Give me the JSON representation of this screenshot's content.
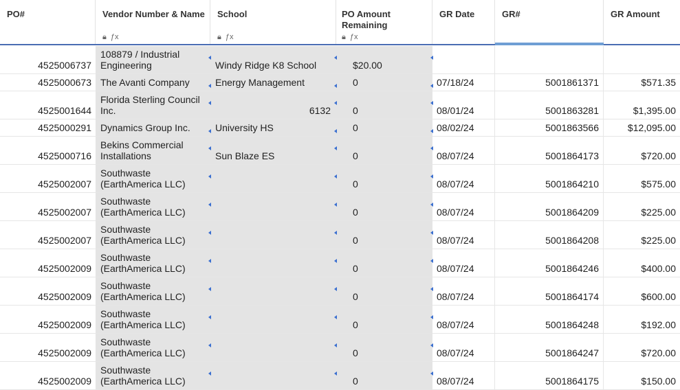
{
  "columns": {
    "po": "PO#",
    "vendor": "Vendor Number & Name",
    "school": "School",
    "amount_line1": "PO Amount",
    "amount_line2": "Remaining",
    "gr_date": "GR Date",
    "gr_num": "GR#",
    "gr_amount": "GR Amount"
  },
  "icons": {
    "lock": "lock-icon",
    "formula": "formula-icon"
  },
  "rows": [
    {
      "po": "4525006737",
      "vendor1": "108879 / Industrial",
      "vendor2": "Engineering",
      "school": "Windy Ridge K8 School",
      "amount": "$20.00",
      "date": "",
      "gr": "",
      "gr_amount": ""
    },
    {
      "po": "4525000673",
      "vendor1": "",
      "vendor2": "The Avanti Company",
      "school": "Energy Management",
      "amount": "0",
      "date": "07/18/24",
      "gr": "5001861371",
      "gr_amount": "$571.35"
    },
    {
      "po": "4525001644",
      "vendor1": "Florida Sterling Council",
      "vendor2": "Inc.",
      "school": "6132",
      "amount": "0",
      "date": "08/01/24",
      "gr": "5001863281",
      "gr_amount": "$1,395.00"
    },
    {
      "po": "4525000291",
      "vendor1": "",
      "vendor2": "Dynamics Group Inc.",
      "school": "University HS",
      "amount": "0",
      "date": "08/02/24",
      "gr": "5001863566",
      "gr_amount": "$12,095.00"
    },
    {
      "po": "4525000716",
      "vendor1": "Bekins Commercial",
      "vendor2": "Installations",
      "school": "Sun Blaze ES",
      "amount": "0",
      "date": "08/07/24",
      "gr": "5001864173",
      "gr_amount": "$720.00"
    },
    {
      "po": "4525002007",
      "vendor1": "Southwaste",
      "vendor2": "(EarthAmerica LLC)",
      "school": "",
      "amount": "0",
      "date": "08/07/24",
      "gr": "5001864210",
      "gr_amount": "$575.00"
    },
    {
      "po": "4525002007",
      "vendor1": "Southwaste",
      "vendor2": "(EarthAmerica LLC)",
      "school": "",
      "amount": "0",
      "date": "08/07/24",
      "gr": "5001864209",
      "gr_amount": "$225.00"
    },
    {
      "po": "4525002007",
      "vendor1": "Southwaste",
      "vendor2": "(EarthAmerica LLC)",
      "school": "",
      "amount": "0",
      "date": "08/07/24",
      "gr": "5001864208",
      "gr_amount": "$225.00"
    },
    {
      "po": "4525002009",
      "vendor1": "Southwaste",
      "vendor2": "(EarthAmerica LLC)",
      "school": "",
      "amount": "0",
      "date": "08/07/24",
      "gr": "5001864246",
      "gr_amount": "$400.00"
    },
    {
      "po": "4525002009",
      "vendor1": "Southwaste",
      "vendor2": "(EarthAmerica LLC)",
      "school": "",
      "amount": "0",
      "date": "08/07/24",
      "gr": "5001864174",
      "gr_amount": "$600.00"
    },
    {
      "po": "4525002009",
      "vendor1": "Southwaste",
      "vendor2": "(EarthAmerica LLC)",
      "school": "",
      "amount": "0",
      "date": "08/07/24",
      "gr": "5001864248",
      "gr_amount": "$192.00"
    },
    {
      "po": "4525002009",
      "vendor1": "Southwaste",
      "vendor2": "(EarthAmerica LLC)",
      "school": "",
      "amount": "0",
      "date": "08/07/24",
      "gr": "5001864247",
      "gr_amount": "$720.00"
    },
    {
      "po": "4525002009",
      "vendor1": "Southwaste",
      "vendor2": "(EarthAmerica LLC)",
      "school": "",
      "amount": "0",
      "date": "08/07/24",
      "gr": "5001864175",
      "gr_amount": "$150.00"
    }
  ]
}
